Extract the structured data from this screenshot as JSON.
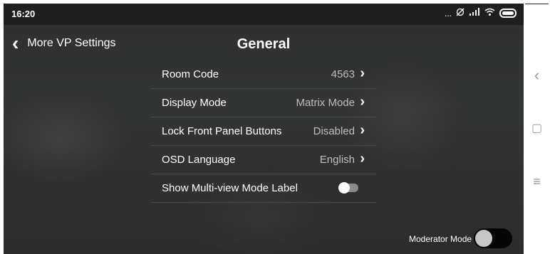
{
  "status_bar": {
    "time": "16:20",
    "icons": [
      "more-dots-icon",
      "alarm-off-icon",
      "signal-icon",
      "wifi-icon",
      "battery-icon"
    ],
    "dots": "..."
  },
  "header": {
    "back_label": "More VP Settings",
    "title": "General"
  },
  "settings": [
    {
      "label": "Room Code",
      "value": "4563",
      "type": "link"
    },
    {
      "label": "Display Mode",
      "value": "Matrix Mode",
      "type": "link"
    },
    {
      "label": "Lock Front Panel Buttons",
      "value": "Disabled",
      "type": "link"
    },
    {
      "label": "OSD Language",
      "value": "English",
      "type": "link"
    },
    {
      "label": "Show Multi-view Mode Label",
      "type": "toggle",
      "on": false
    }
  ],
  "footer": {
    "moderator_label": "Moderator Mode",
    "moderator_on": false
  },
  "nav": {
    "back_glyph": "‹",
    "home_glyph": "▢",
    "menu_glyph": "≡"
  },
  "colors": {
    "background": "#303131",
    "status_bar": "#1f1f1f",
    "text": "#ffffff",
    "value_text": "#bdbdbd",
    "toggle_track": "#8a8a8a"
  }
}
